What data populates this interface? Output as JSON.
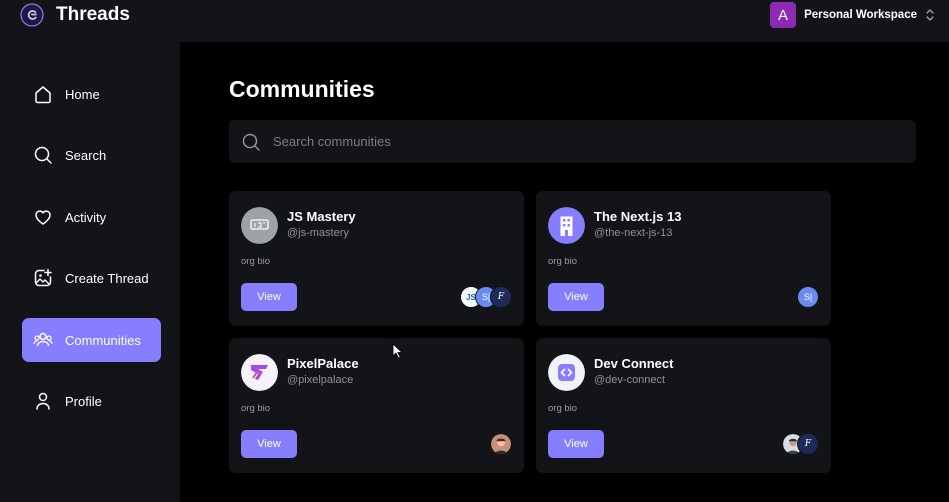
{
  "app": {
    "brand": "Threads"
  },
  "workspace": {
    "avatar_letter": "A",
    "name": "Personal Workspace"
  },
  "sidebar": {
    "items": [
      {
        "label": "Home",
        "icon": "home-icon",
        "active": false
      },
      {
        "label": "Search",
        "icon": "search-icon",
        "active": false
      },
      {
        "label": "Activity",
        "icon": "heart-icon",
        "active": false
      },
      {
        "label": "Create Thread",
        "icon": "gallery-add-icon",
        "active": false
      },
      {
        "label": "Communities",
        "icon": "members-icon",
        "active": true
      },
      {
        "label": "Profile",
        "icon": "user-icon",
        "active": false
      }
    ]
  },
  "main": {
    "title": "Communities",
    "search": {
      "placeholder": "Search communities",
      "value": ""
    },
    "communities": [
      {
        "name": "JS Mastery",
        "handle": "@js-mastery",
        "bio": "org bio",
        "view_label": "View",
        "members": [
          "JS",
          "S|",
          "F"
        ]
      },
      {
        "name": "The Next.js 13",
        "handle": "@the-next-js-13",
        "bio": "org bio",
        "view_label": "View",
        "members": [
          "S|"
        ]
      },
      {
        "name": "PixelPalace",
        "handle": "@pixelpalace",
        "bio": "org bio",
        "view_label": "View",
        "members": [
          "photo"
        ]
      },
      {
        "name": "Dev Connect",
        "handle": "@dev-connect",
        "bio": "org bio",
        "view_label": "View",
        "members": [
          "photo",
          "F"
        ]
      }
    ]
  },
  "colors": {
    "accent": "#877eff",
    "surface": "#121417",
    "background": "#000000",
    "workspace_avatar": "#8b2bb3"
  }
}
